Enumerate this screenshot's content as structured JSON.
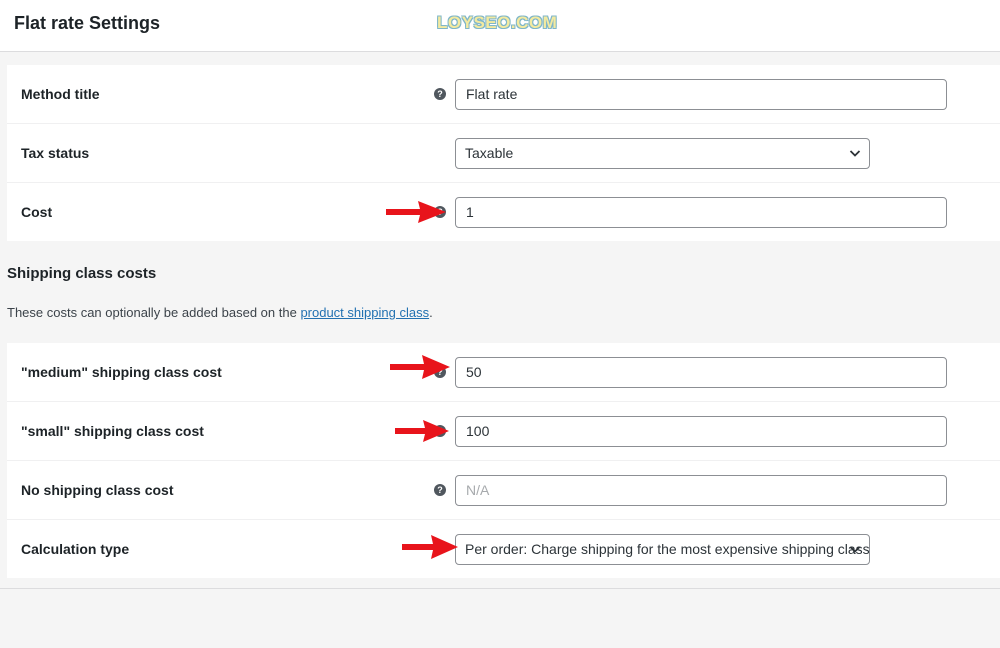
{
  "header": {
    "title": "Flat rate Settings",
    "watermark": "LOYSEO.COM"
  },
  "general_settings": [
    {
      "label": "Method title",
      "value": "Flat rate",
      "type": "text",
      "help": true
    },
    {
      "label": "Tax status",
      "value": "Taxable",
      "type": "select",
      "help": false
    },
    {
      "label": "Cost",
      "value": "1",
      "type": "text",
      "help": true
    }
  ],
  "shipping_class_section": {
    "title": "Shipping class costs",
    "description_prefix": "These costs can optionally be added based on the ",
    "description_link": "product shipping class",
    "description_suffix": "."
  },
  "class_settings": [
    {
      "label": "\"medium\" shipping class cost",
      "value": "50",
      "type": "text",
      "help": true
    },
    {
      "label": "\"small\" shipping class cost",
      "value": "100",
      "type": "text",
      "help": true
    },
    {
      "label": "No shipping class cost",
      "value": "",
      "placeholder": "N/A",
      "type": "text",
      "help": true
    },
    {
      "label": "Calculation type",
      "value": "Per order: Charge shipping for the most expensive shipping class",
      "type": "select",
      "help": false
    }
  ],
  "icons": {
    "help": "question-circle-icon",
    "select_arrow": "chevron-down-icon",
    "annotation": "red-arrow-icon"
  },
  "colors": {
    "annotation_arrow": "#e8141b",
    "link": "#2271b1",
    "background": "#f5f5f5"
  }
}
